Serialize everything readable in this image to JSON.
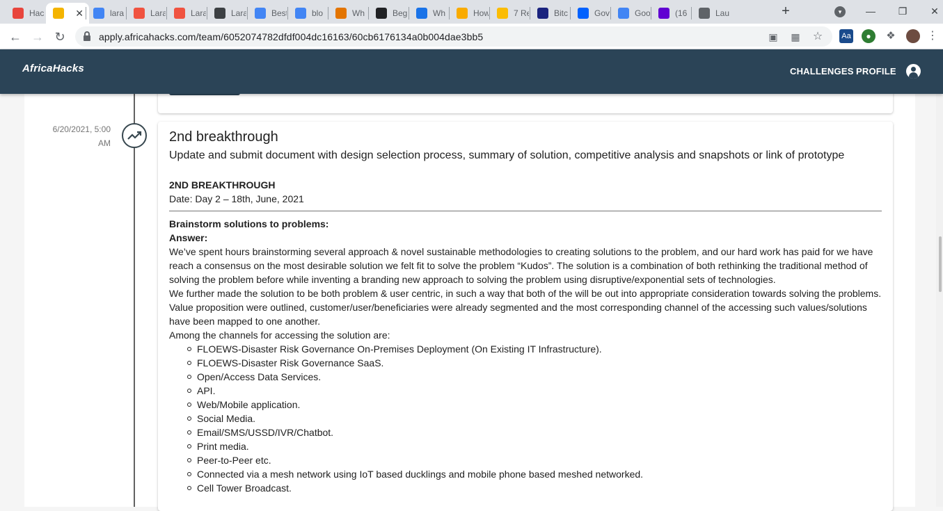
{
  "browser": {
    "tabs": [
      {
        "title": "Hac",
        "icon": "hackathon-favicon",
        "color": "#e8453c"
      },
      {
        "title": "",
        "icon": "page-favicon",
        "color": "#f4b400"
      },
      {
        "title": "lara",
        "icon": "google-icon",
        "color": "#4285f4"
      },
      {
        "title": "Lara",
        "icon": "laravel-icon",
        "color": "#f05340"
      },
      {
        "title": "Lara",
        "icon": "laravel-icon",
        "color": "#f05340"
      },
      {
        "title": "Lara",
        "icon": "paper-plane-icon",
        "color": "#3c4043"
      },
      {
        "title": "Best",
        "icon": "docs-icon",
        "color": "#4285f4"
      },
      {
        "title": "blo",
        "icon": "google-icon",
        "color": "#4285f4"
      },
      {
        "title": "Wh",
        "icon": "rocket-icon",
        "color": "#e37400"
      },
      {
        "title": "Beg",
        "icon": "m-icon",
        "color": "#202124"
      },
      {
        "title": "Wh",
        "icon": "gear-icon",
        "color": "#1a73e8"
      },
      {
        "title": "How",
        "icon": "b-icon",
        "color": "#f9ab00"
      },
      {
        "title": "7 Re",
        "icon": "circle-icon",
        "color": "#fbbc04"
      },
      {
        "title": "Bitc",
        "icon": "w-icon",
        "color": "#1a237e"
      },
      {
        "title": "Gov",
        "icon": "dropbox-icon",
        "color": "#0061fe"
      },
      {
        "title": "Goo",
        "icon": "google-icon",
        "color": "#4285f4"
      },
      {
        "title": "(16",
        "icon": "mail-icon",
        "color": "#6001d2"
      },
      {
        "title": "Lau",
        "icon": "globe-icon",
        "color": "#5f6368"
      }
    ],
    "tab_close_glyph": "✕",
    "new_tab_glyph": "+",
    "url": "apply.africahacks.com/team/6052074782dfdf004dc16163/60cb6176134a0b004dae3bb5"
  },
  "app": {
    "brand": "AfricaHacks",
    "nav": {
      "challenges": "CHALLENGES",
      "profile": "PROFILE"
    },
    "colors": {
      "header": "#2b4457"
    }
  },
  "timeline": {
    "date_line1": "6/20/2021, 5:00",
    "date_line2": "AM",
    "icon": "trending-up-icon"
  },
  "card": {
    "title": "2nd breakthrough",
    "subtitle": "Update and submit document with design selection process, summary of solution, competitive analysis and snapshots or link of prototype",
    "section_heading": "2ND BREAKTHROUGH",
    "section_date": "Date: Day 2 – 18th, June, 2021",
    "question": "Brainstorm solutions to problems:",
    "answer_label": "Answer:",
    "paragraph1": "We’ve spent hours brainstorming several approach & novel sustainable methodologies to creating solutions to the problem, and our hard work has paid for we have reach a consensus on the most desirable solution we felt fit to solve the problem “Kudos”. The solution is a combination of both rethinking the traditional method of solving the problem before while inventing a branding new approach to solving the problem using disruptive/exponential sets of technologies.",
    "paragraph2": "We further made the solution to be both problem & user centric, in such a way that both of the will be out into appropriate consideration towards solving the problems. Value proposition were outlined, customer/user/beneficiaries were already segmented and the most corresponding channel of the accessing such values/solutions have been mapped to one another.",
    "channels_intro": "Among the channels for accessing the solution are:",
    "channels": [
      "FLOEWS-Disaster Risk Governance On-Premises Deployment (On Existing IT Infrastructure).",
      "FLOEWS-Disaster Risk Governance SaaS.",
      "Open/Access Data Services.",
      "API.",
      "Web/Mobile application.",
      "Social Media.",
      "Email/SMS/USSD/IVR/Chatbot.",
      "Print media.",
      "Peer-to-Peer etc.",
      "Connected via a mesh network using IoT based ducklings and mobile phone based meshed networked.",
      "Cell Tower Broadcast."
    ]
  }
}
